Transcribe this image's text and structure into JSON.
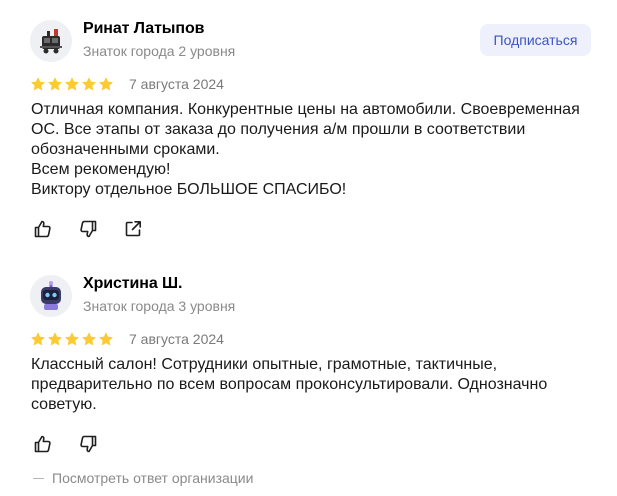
{
  "reviews": [
    {
      "author": "Ринат Латыпов",
      "level": "Знаток города 2 уровня",
      "subscribe_label": "Подписаться",
      "rating": 5,
      "date": "7 августа 2024",
      "text_lines": [
        "Отличная компания. Конкурентные цены на автомобили. Своевременная",
        "ОС. Все этапы от заказа до получения а/м прошли в соответствии",
        "обозначенными сроками.",
        "Всем рекомендую!",
        "Виктору отдельное БОЛЬШОЕ СПАСИБО!"
      ],
      "avatar_icon": "robot-train-icon"
    },
    {
      "author": "Христина Ш.",
      "level": "Знаток города 3 уровня",
      "rating": 5,
      "date": "7 августа 2024",
      "text_lines": [
        "Классный салон! Сотрудники опытные, грамотные, тактичные,",
        "предварительно по всем вопросам проконсультировали. Однозначно",
        "советую."
      ],
      "avatar_icon": "robot-face-icon"
    }
  ],
  "org_reply_label": "Посмотреть ответ организации",
  "colors": {
    "star": "#fccb33",
    "subscribe_bg": "#eef1fb",
    "subscribe_text": "#3a55c4",
    "muted_text": "#8a8a8a",
    "icon": "#1f1f1f"
  }
}
